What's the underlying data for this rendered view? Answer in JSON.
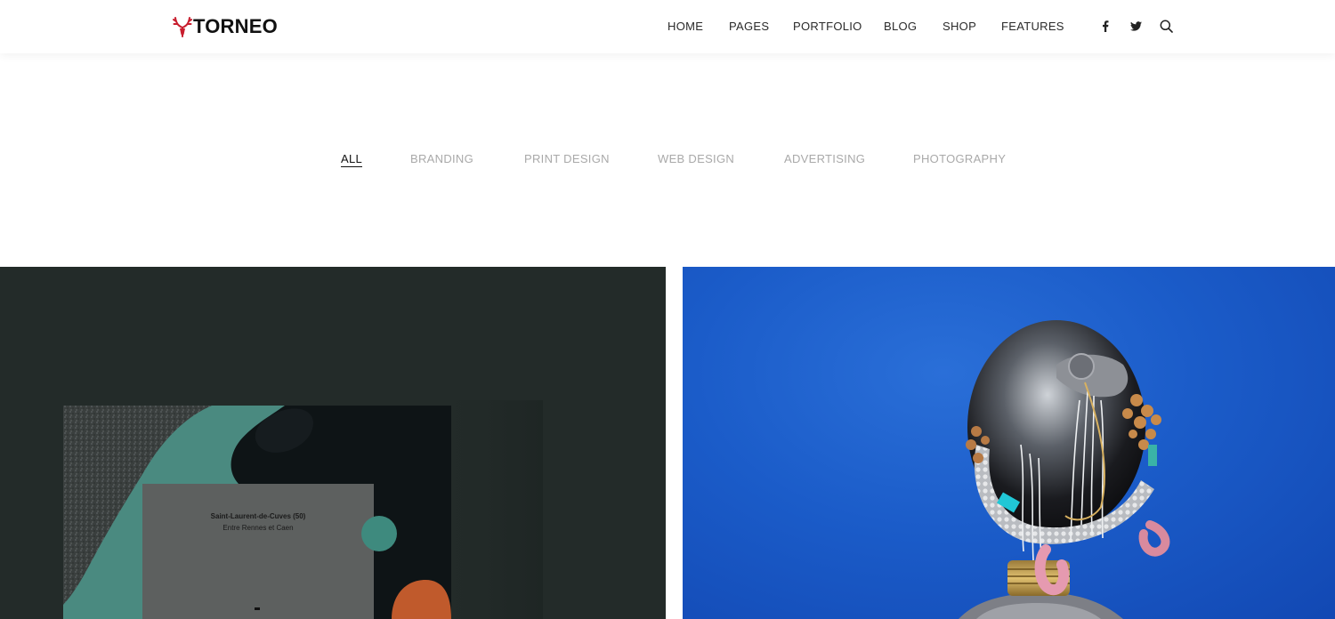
{
  "brand": {
    "name": "TORNEO",
    "accent_color": "#c81e2e"
  },
  "nav": {
    "items": [
      {
        "label": "HOME"
      },
      {
        "label": "PAGES"
      },
      {
        "label": "PORTFOLIO"
      },
      {
        "label": "BLOG"
      },
      {
        "label": "SHOP"
      },
      {
        "label": "FEATURES"
      }
    ],
    "icons": [
      "facebook-icon",
      "twitter-icon",
      "search-icon"
    ]
  },
  "filters": {
    "items": [
      {
        "label": "ALL",
        "active": true
      },
      {
        "label": "BRANDING",
        "active": false
      },
      {
        "label": "PRINT DESIGN",
        "active": false
      },
      {
        "label": "WEB DESIGN",
        "active": false
      },
      {
        "label": "ADVERTISING",
        "active": false
      },
      {
        "label": "PHOTOGRAPHY",
        "active": false
      }
    ]
  },
  "portfolio": {
    "items": [
      {
        "background": "#232b29",
        "card_title": "Saint-Laurent-de-Cuves (50)",
        "card_subtitle": "Entre Rennes et Caen"
      },
      {
        "background": "#1b5cc9"
      }
    ]
  }
}
